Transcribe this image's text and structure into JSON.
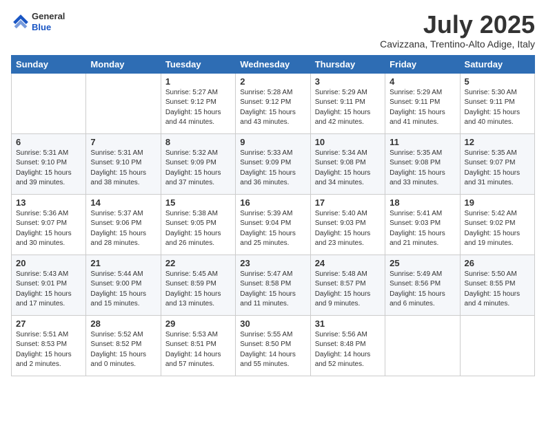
{
  "logo": {
    "general": "General",
    "blue": "Blue"
  },
  "header": {
    "month": "July 2025",
    "location": "Cavizzana, Trentino-Alto Adige, Italy"
  },
  "weekdays": [
    "Sunday",
    "Monday",
    "Tuesday",
    "Wednesday",
    "Thursday",
    "Friday",
    "Saturday"
  ],
  "weeks": [
    [
      {
        "day": "",
        "info": ""
      },
      {
        "day": "",
        "info": ""
      },
      {
        "day": "1",
        "info": "Sunrise: 5:27 AM\nSunset: 9:12 PM\nDaylight: 15 hours\nand 44 minutes."
      },
      {
        "day": "2",
        "info": "Sunrise: 5:28 AM\nSunset: 9:12 PM\nDaylight: 15 hours\nand 43 minutes."
      },
      {
        "day": "3",
        "info": "Sunrise: 5:29 AM\nSunset: 9:11 PM\nDaylight: 15 hours\nand 42 minutes."
      },
      {
        "day": "4",
        "info": "Sunrise: 5:29 AM\nSunset: 9:11 PM\nDaylight: 15 hours\nand 41 minutes."
      },
      {
        "day": "5",
        "info": "Sunrise: 5:30 AM\nSunset: 9:11 PM\nDaylight: 15 hours\nand 40 minutes."
      }
    ],
    [
      {
        "day": "6",
        "info": "Sunrise: 5:31 AM\nSunset: 9:10 PM\nDaylight: 15 hours\nand 39 minutes."
      },
      {
        "day": "7",
        "info": "Sunrise: 5:31 AM\nSunset: 9:10 PM\nDaylight: 15 hours\nand 38 minutes."
      },
      {
        "day": "8",
        "info": "Sunrise: 5:32 AM\nSunset: 9:09 PM\nDaylight: 15 hours\nand 37 minutes."
      },
      {
        "day": "9",
        "info": "Sunrise: 5:33 AM\nSunset: 9:09 PM\nDaylight: 15 hours\nand 36 minutes."
      },
      {
        "day": "10",
        "info": "Sunrise: 5:34 AM\nSunset: 9:08 PM\nDaylight: 15 hours\nand 34 minutes."
      },
      {
        "day": "11",
        "info": "Sunrise: 5:35 AM\nSunset: 9:08 PM\nDaylight: 15 hours\nand 33 minutes."
      },
      {
        "day": "12",
        "info": "Sunrise: 5:35 AM\nSunset: 9:07 PM\nDaylight: 15 hours\nand 31 minutes."
      }
    ],
    [
      {
        "day": "13",
        "info": "Sunrise: 5:36 AM\nSunset: 9:07 PM\nDaylight: 15 hours\nand 30 minutes."
      },
      {
        "day": "14",
        "info": "Sunrise: 5:37 AM\nSunset: 9:06 PM\nDaylight: 15 hours\nand 28 minutes."
      },
      {
        "day": "15",
        "info": "Sunrise: 5:38 AM\nSunset: 9:05 PM\nDaylight: 15 hours\nand 26 minutes."
      },
      {
        "day": "16",
        "info": "Sunrise: 5:39 AM\nSunset: 9:04 PM\nDaylight: 15 hours\nand 25 minutes."
      },
      {
        "day": "17",
        "info": "Sunrise: 5:40 AM\nSunset: 9:03 PM\nDaylight: 15 hours\nand 23 minutes."
      },
      {
        "day": "18",
        "info": "Sunrise: 5:41 AM\nSunset: 9:03 PM\nDaylight: 15 hours\nand 21 minutes."
      },
      {
        "day": "19",
        "info": "Sunrise: 5:42 AM\nSunset: 9:02 PM\nDaylight: 15 hours\nand 19 minutes."
      }
    ],
    [
      {
        "day": "20",
        "info": "Sunrise: 5:43 AM\nSunset: 9:01 PM\nDaylight: 15 hours\nand 17 minutes."
      },
      {
        "day": "21",
        "info": "Sunrise: 5:44 AM\nSunset: 9:00 PM\nDaylight: 15 hours\nand 15 minutes."
      },
      {
        "day": "22",
        "info": "Sunrise: 5:45 AM\nSunset: 8:59 PM\nDaylight: 15 hours\nand 13 minutes."
      },
      {
        "day": "23",
        "info": "Sunrise: 5:47 AM\nSunset: 8:58 PM\nDaylight: 15 hours\nand 11 minutes."
      },
      {
        "day": "24",
        "info": "Sunrise: 5:48 AM\nSunset: 8:57 PM\nDaylight: 15 hours\nand 9 minutes."
      },
      {
        "day": "25",
        "info": "Sunrise: 5:49 AM\nSunset: 8:56 PM\nDaylight: 15 hours\nand 6 minutes."
      },
      {
        "day": "26",
        "info": "Sunrise: 5:50 AM\nSunset: 8:55 PM\nDaylight: 15 hours\nand 4 minutes."
      }
    ],
    [
      {
        "day": "27",
        "info": "Sunrise: 5:51 AM\nSunset: 8:53 PM\nDaylight: 15 hours\nand 2 minutes."
      },
      {
        "day": "28",
        "info": "Sunrise: 5:52 AM\nSunset: 8:52 PM\nDaylight: 15 hours\nand 0 minutes."
      },
      {
        "day": "29",
        "info": "Sunrise: 5:53 AM\nSunset: 8:51 PM\nDaylight: 14 hours\nand 57 minutes."
      },
      {
        "day": "30",
        "info": "Sunrise: 5:55 AM\nSunset: 8:50 PM\nDaylight: 14 hours\nand 55 minutes."
      },
      {
        "day": "31",
        "info": "Sunrise: 5:56 AM\nSunset: 8:48 PM\nDaylight: 14 hours\nand 52 minutes."
      },
      {
        "day": "",
        "info": ""
      },
      {
        "day": "",
        "info": ""
      }
    ]
  ]
}
